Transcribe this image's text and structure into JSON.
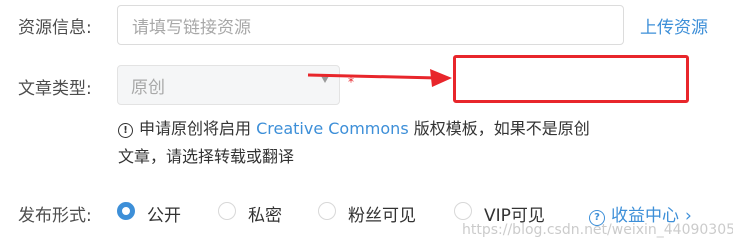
{
  "resource": {
    "label": "资源信息:",
    "placeholder": "请填写链接资源",
    "upload_link": "上传资源"
  },
  "article_type": {
    "label": "文章类型:",
    "selected": "原创",
    "required_mark": "*"
  },
  "annotation": {
    "color": "#e8262b"
  },
  "notice": {
    "text_before": "申请原创将启用 ",
    "link_text": "Creative Commons",
    "text_after": " 版权模板，如果不是原创文章，请选择转载或翻译"
  },
  "publish": {
    "label": "发布形式:",
    "options": [
      {
        "label": "公开",
        "checked": true
      },
      {
        "label": "私密",
        "checked": false
      },
      {
        "label": "粉丝可见",
        "checked": false
      },
      {
        "label": "VIP可见",
        "checked": false
      }
    ],
    "revenue_link": "收益中心",
    "revenue_chevron": "›"
  },
  "watermark": "https://blog.csdn.net/weixin_44090305",
  "colors": {
    "accent": "#3d8fd8",
    "annotation_red": "#e8262b"
  }
}
